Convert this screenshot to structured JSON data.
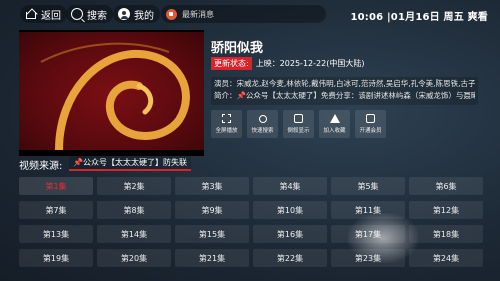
{
  "topbar": {
    "back_label": "返回",
    "search_label": "搜索",
    "mine_label": "我的",
    "news_label": "最新消息",
    "clock": "10:06 |01月16日 周五  爽看"
  },
  "detail": {
    "title": "骄阳似我",
    "status_badge": "更新状态:",
    "release": "上映：2025-12-22(中国大陆)",
    "cast": "演员：宋威龙,赵今麦,林依轮,戴伟明,白冰可,范诗然,吴启华,孔令美,陈思铁,古子成...",
    "intro": "简介：📌公众号【太太太硬了】免费分享：该剧讲述林屿森（宋威龙饰）与聂曦光..."
  },
  "actions": [
    {
      "label": "全屏播放",
      "icon": "fullscreen-icon"
    },
    {
      "label": "快速搜索",
      "icon": "search-icon"
    },
    {
      "label": "倒叙显示",
      "icon": "reverse-icon"
    },
    {
      "label": "加入收藏",
      "icon": "favorite-icon"
    },
    {
      "label": "开通会员",
      "icon": "vip-icon"
    }
  ],
  "source": {
    "label": "视频来源:",
    "selected": "📌公众号【太太太硬了】防失联"
  },
  "episodes": [
    "第1集",
    "第2集",
    "第3集",
    "第4集",
    "第5集",
    "第6集",
    "第7集",
    "第8集",
    "第9集",
    "第10集",
    "第11集",
    "第12集",
    "第13集",
    "第14集",
    "第15集",
    "第16集",
    "第17集",
    "第18集",
    "第19集",
    "第20集",
    "第21集",
    "第22集",
    "第23集",
    "第24集"
  ],
  "colors": {
    "accent": "#d8232a",
    "active_episode": "#e0303a"
  }
}
